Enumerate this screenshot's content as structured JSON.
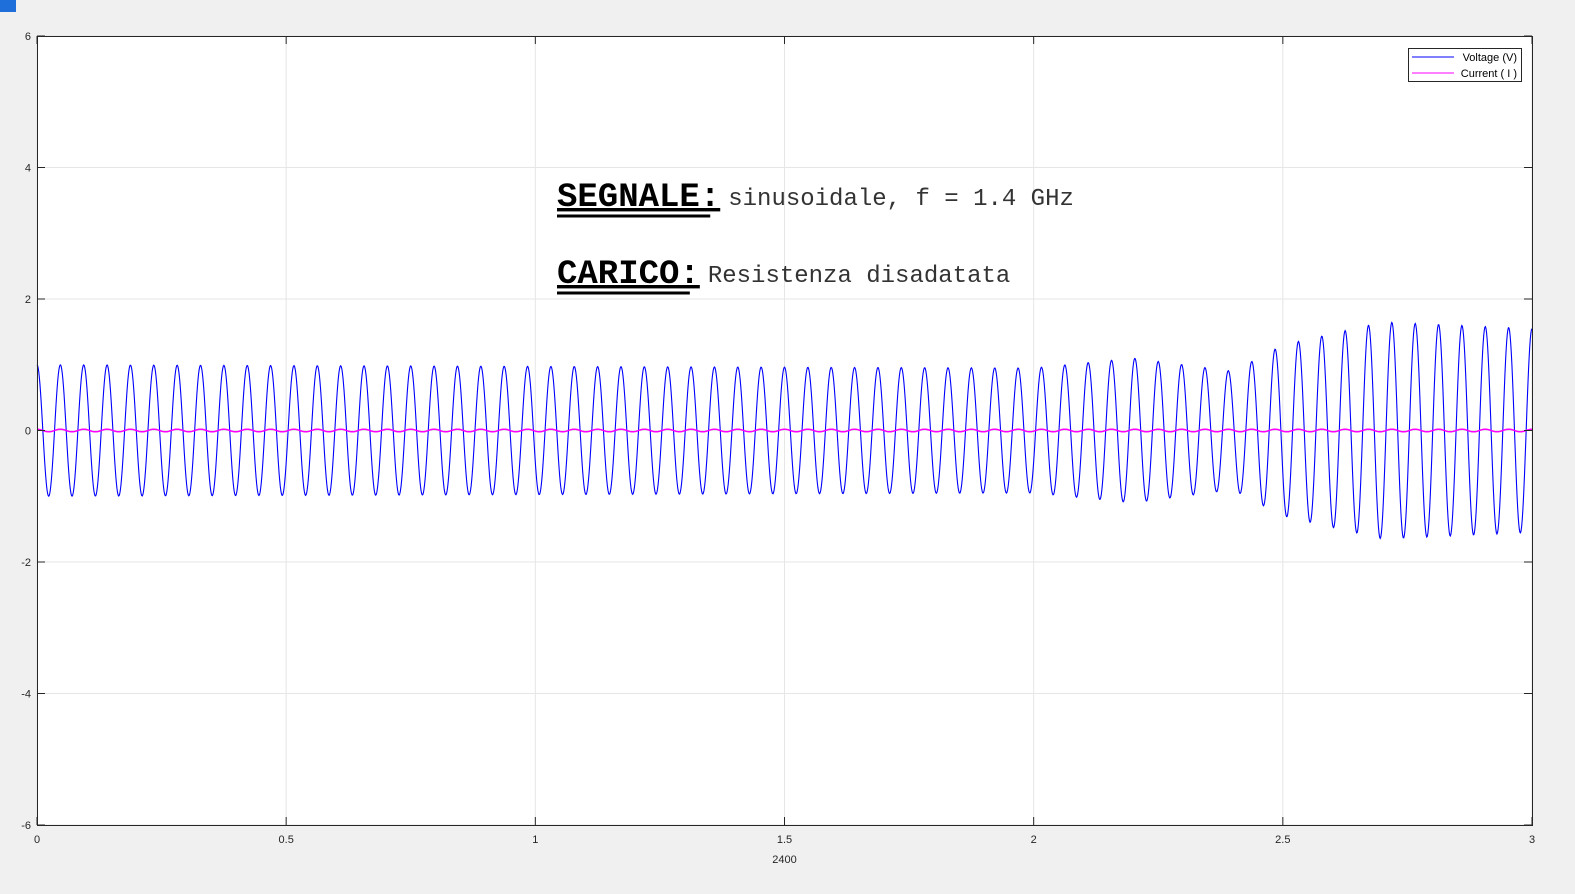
{
  "chart_data": {
    "type": "line",
    "title": "",
    "xlabel": "2400",
    "ylabel": "",
    "xlim": [
      0,
      3
    ],
    "ylim": [
      -6,
      6
    ],
    "xticks": [
      0,
      0.5,
      1,
      1.5,
      2,
      2.5,
      3
    ],
    "xtick_labels": [
      "0",
      "0.5",
      "1",
      "1.5",
      "2",
      "2.5",
      "3"
    ],
    "yticks": [
      6,
      4,
      2,
      0,
      -2,
      -4,
      -6
    ],
    "ytick_labels": [
      "6",
      "4",
      "2",
      "0",
      "-2",
      "-4",
      "-6"
    ],
    "grid": true,
    "legend_position": "top-right",
    "series": [
      {
        "name": "Voltage (V)",
        "color": "#0000ff",
        "waveform": "sinusoid",
        "cycles_in_view": 64,
        "amplitude_envelope": [
          {
            "x": 0,
            "amp": 1.0
          },
          {
            "x": 2.0,
            "amp": 0.95
          },
          {
            "x": 2.2,
            "amp": 1.1
          },
          {
            "x": 2.4,
            "amp": 0.9
          },
          {
            "x": 2.5,
            "amp": 1.3
          },
          {
            "x": 2.7,
            "amp": 1.65
          },
          {
            "x": 3.0,
            "amp": 1.55
          }
        ]
      },
      {
        "name": "Current ( I )",
        "color": "#ff00ff",
        "waveform": "sinusoid",
        "cycles_in_view": 64,
        "amplitude": 0.02
      }
    ],
    "annotations": [
      {
        "label": "SEGNALE:",
        "text": "sinusoidale, f = 1.4 GHz"
      },
      {
        "label": "CARICO:",
        "text": "Resistenza disadatata"
      }
    ]
  }
}
